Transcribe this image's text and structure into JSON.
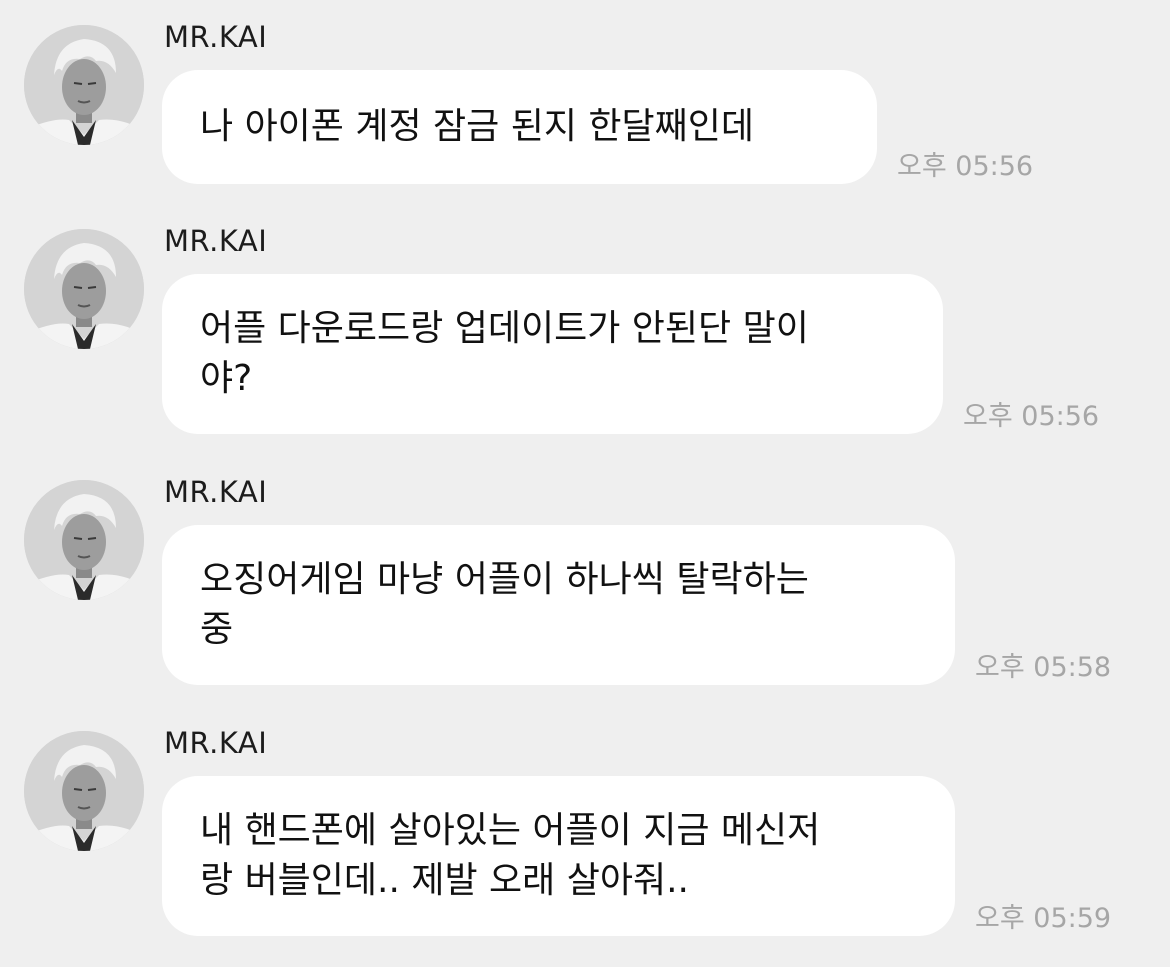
{
  "messages": [
    {
      "sender": "MR.KAI",
      "lines": [
        "나 아이폰 계정 잠금 된지 한달째인데"
      ],
      "time": "오후 05:56"
    },
    {
      "sender": "MR.KAI",
      "lines": [
        "어플 다운로드랑 업데이트가 안된단 말이",
        "야?"
      ],
      "time": "오후 05:56"
    },
    {
      "sender": "MR.KAI",
      "lines": [
        "오징어게임 마냥 어플이 하나씩 탈락하는",
        "중"
      ],
      "time": "오후 05:58"
    },
    {
      "sender": "MR.KAI",
      "lines": [
        "내 핸드폰에 살아있는 어플이 지금 메신저",
        "랑 버블인데.. 제발 오래 살아줘.."
      ],
      "time": "오후 05:59"
    }
  ]
}
